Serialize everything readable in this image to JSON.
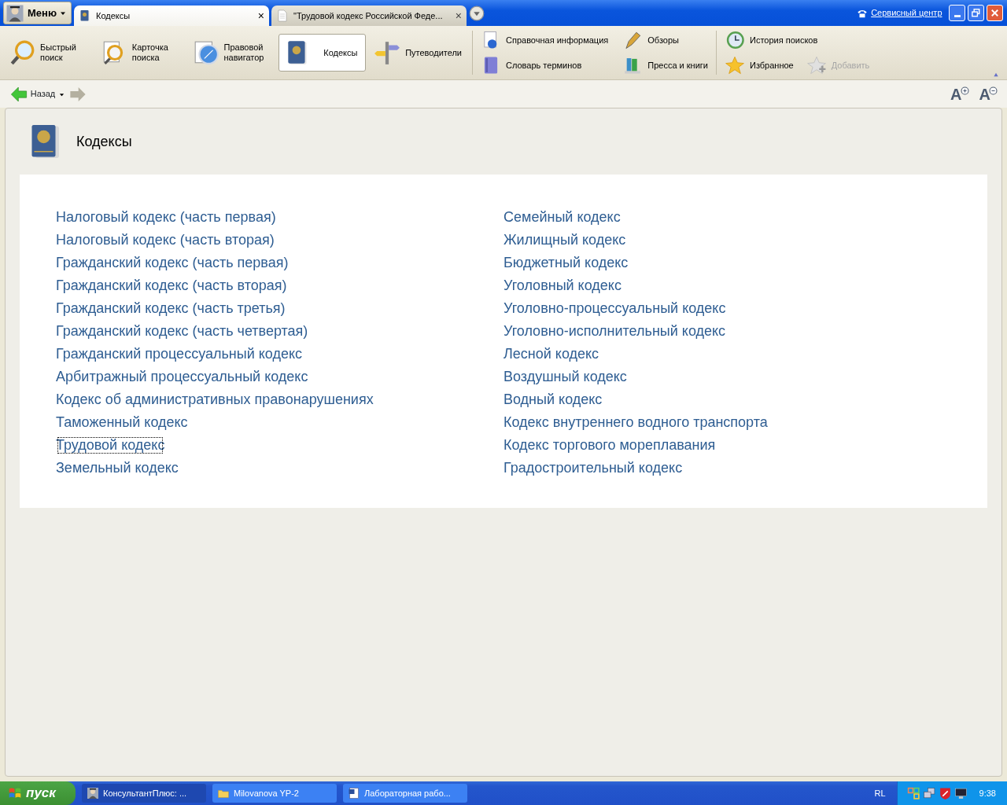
{
  "title_bar": {
    "menu_button": "Меню",
    "tabs": [
      {
        "label": "Кодексы",
        "kind": "book",
        "selected": true,
        "close": "×"
      },
      {
        "label": "\"Трудовой кодекс Российской Феде...",
        "kind": "doc",
        "selected": false,
        "close": "×"
      }
    ],
    "service_link": "Сервисный центр"
  },
  "toolbar": {
    "main": [
      {
        "label": "Быстрый поиск",
        "kind": "magnifier",
        "selected": false
      },
      {
        "label": "Карточка поиска",
        "kind": "card",
        "selected": false
      },
      {
        "label": "Правовой навигатор",
        "kind": "compass",
        "selected": false
      },
      {
        "label": "Кодексы",
        "kind": "book",
        "selected": true
      },
      {
        "label": "Путеводители",
        "kind": "signpost",
        "selected": false
      }
    ],
    "info": [
      {
        "label": "Справочная информация",
        "kind": "question"
      },
      {
        "label": "Обзоры",
        "kind": "pen"
      },
      {
        "label": "Словарь терминов",
        "kind": "dictionary"
      },
      {
        "label": "Пресса и книги",
        "kind": "books"
      }
    ],
    "history": [
      {
        "label": "История поисков",
        "kind": "clock",
        "disabled": false
      },
      {
        "label": "Избранное",
        "kind": "star",
        "disabled": false
      },
      {
        "label": "Добавить",
        "kind": "star-plus",
        "disabled": true
      }
    ]
  },
  "nav": {
    "back": "Назад",
    "font_buttons": [
      {
        "letter": "A",
        "kind": "increase"
      },
      {
        "letter": "A",
        "kind": "decrease"
      }
    ]
  },
  "page": {
    "title": "Кодексы",
    "columns": [
      [
        {
          "label": "Налоговый кодекс (часть первая)",
          "focused": false
        },
        {
          "label": "Налоговый кодекс (часть вторая)",
          "focused": false
        },
        {
          "label": "Гражданский кодекс (часть первая)",
          "focused": false
        },
        {
          "label": "Гражданский кодекс (часть вторая)",
          "focused": false
        },
        {
          "label": "Гражданский кодекс (часть третья)",
          "focused": false
        },
        {
          "label": "Гражданский кодекс (часть четвертая)",
          "focused": false
        },
        {
          "label": "Гражданский процессуальный кодекс",
          "focused": false
        },
        {
          "label": "Арбитражный процессуальный кодекс",
          "focused": false
        },
        {
          "label": "Кодекс об административных правонарушениях",
          "focused": false
        },
        {
          "label": "Таможенный кодекс",
          "focused": false
        },
        {
          "label": "Трудовой кодекс",
          "focused": true
        },
        {
          "label": "Земельный кодекс",
          "focused": false
        }
      ],
      [
        {
          "label": "Семейный кодекс",
          "focused": false
        },
        {
          "label": "Жилищный кодекс",
          "focused": false
        },
        {
          "label": "Бюджетный кодекс",
          "focused": false
        },
        {
          "label": "Уголовный кодекс",
          "focused": false
        },
        {
          "label": "Уголовно-процессуальный кодекс",
          "focused": false
        },
        {
          "label": "Уголовно-исполнительный кодекс",
          "focused": false
        },
        {
          "label": "Лесной кодекс",
          "focused": false
        },
        {
          "label": "Воздушный кодекс",
          "focused": false
        },
        {
          "label": "Водный кодекс",
          "focused": false
        },
        {
          "label": "Кодекс внутреннего водного транспорта",
          "focused": false
        },
        {
          "label": "Кодекс торгового мореплавания",
          "focused": false
        },
        {
          "label": "Градостроительный кодекс",
          "focused": false
        }
      ]
    ]
  },
  "taskbar": {
    "start": "пуск",
    "tasks": [
      {
        "label": "КонсультантПлюс: ...",
        "kind": "figure",
        "selected": true
      },
      {
        "label": "Milovanova YP-2",
        "kind": "folder",
        "selected": false
      },
      {
        "label": "Лабораторная рабо...",
        "kind": "document",
        "selected": false
      }
    ],
    "language": "RL",
    "time": "9:38"
  }
}
